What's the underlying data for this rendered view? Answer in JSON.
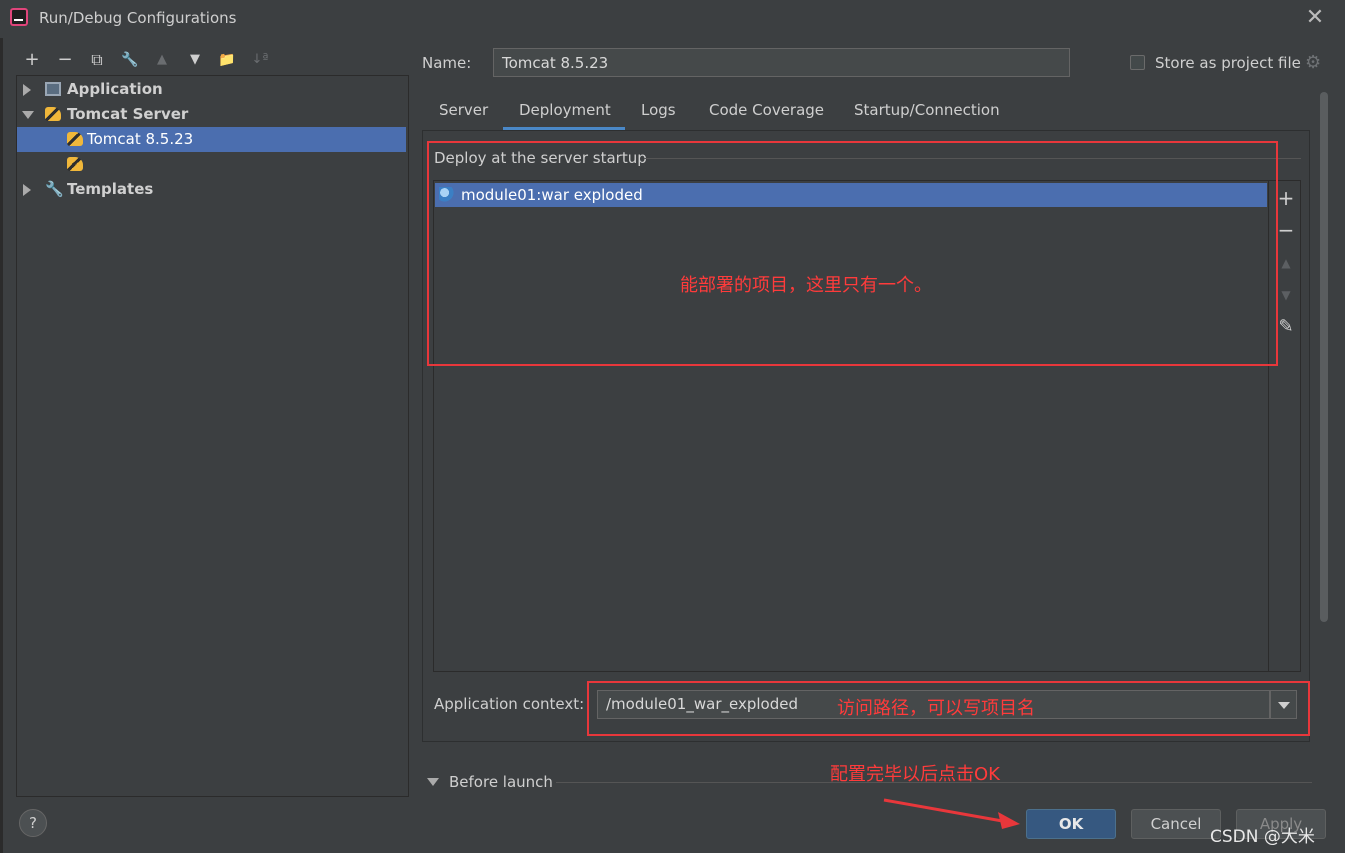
{
  "window": {
    "title": "Run/Debug Configurations",
    "close": "✕"
  },
  "toolbar": {
    "add": "+",
    "remove": "−",
    "copy": "⧉",
    "edit": "🔧",
    "up": "▲",
    "down": "▼",
    "folder": "📁",
    "sort": "↓ª"
  },
  "tree": {
    "items": [
      {
        "label": "Application"
      },
      {
        "label": "Tomcat Server"
      },
      {
        "label": "Tomcat 8.5.23"
      },
      {
        "label": ""
      },
      {
        "label": "Templates"
      }
    ]
  },
  "form": {
    "name_label": "Name:",
    "name_value": "Tomcat 8.5.23",
    "store_label": "Store as project file"
  },
  "tabs": [
    {
      "label": "Server"
    },
    {
      "label": "Deployment"
    },
    {
      "label": "Logs"
    },
    {
      "label": "Code Coverage"
    },
    {
      "label": "Startup/Connection"
    }
  ],
  "deployment": {
    "section_title": "Deploy at the server startup",
    "artifact": "module01:war exploded",
    "side_add": "+",
    "side_remove": "−",
    "side_edit": "✎",
    "context_label": "Application context:",
    "context_value": "/module01_war_exploded"
  },
  "before_launch": {
    "label": "Before launch"
  },
  "buttons": {
    "help": "?",
    "ok": "OK",
    "cancel": "Cancel",
    "apply": "Apply"
  },
  "annotations": {
    "deploy_note": "能部署的项目，这里只有一个。",
    "context_note": "访问路径，可以写项目名",
    "ok_note": "配置完毕以后点击OK"
  },
  "watermark": "CSDN @大米"
}
